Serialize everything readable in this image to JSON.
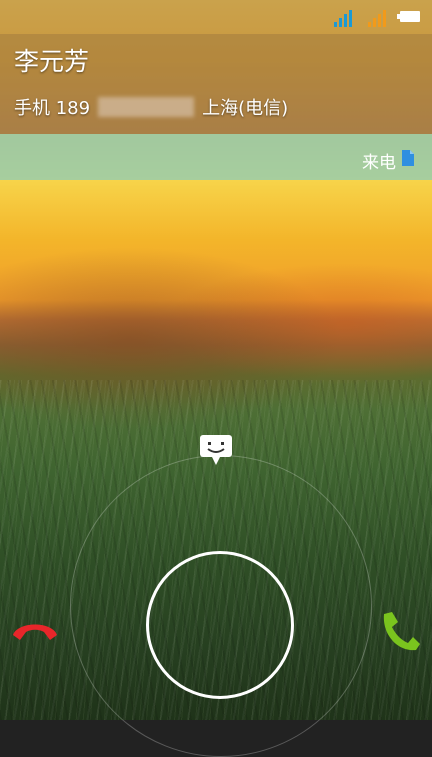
{
  "status_bar": {
    "signal_color_1": "#1a9ad6",
    "signal_color_2": "#f29a1a",
    "battery": "battery-full-icon"
  },
  "caller": {
    "name": "李元芳",
    "number_prefix": "手机 189",
    "location": "上海(电信)"
  },
  "call_type": {
    "label": "来电",
    "icon": "document-icon"
  },
  "actions": {
    "message": "message-icon",
    "answer_ring": "slide-answer-ring",
    "decline": "phone-decline-icon",
    "accept": "phone-accept-icon",
    "decline_color": "#e8262a",
    "accept_color": "#7ac41e"
  }
}
